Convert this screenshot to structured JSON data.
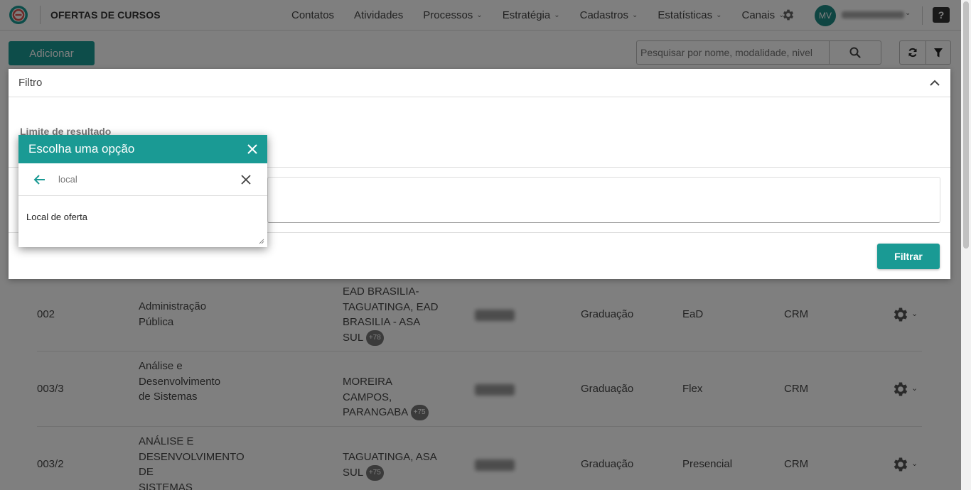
{
  "header": {
    "app_title": "OFERTAS DE CURSOS",
    "nav": [
      {
        "label": "Contatos",
        "dropdown": false
      },
      {
        "label": "Atividades",
        "dropdown": false
      },
      {
        "label": "Processos",
        "dropdown": true
      },
      {
        "label": "Estratégia",
        "dropdown": true
      },
      {
        "label": "Cadastros",
        "dropdown": true
      },
      {
        "label": "Estatísticas",
        "dropdown": true
      },
      {
        "label": "Canais",
        "dropdown": true
      }
    ],
    "avatar_initials": "MV",
    "help_label": "?"
  },
  "toolbar": {
    "add_label": "Adicionar",
    "search_placeholder": "Pesquisar por nome, modalidade, nivel"
  },
  "table": {
    "rows": [
      {
        "code": "002",
        "name": "Administração Pública",
        "local": "EAD BRASILIA-TAGUATINGA, EAD BRASILIA - ASA SUL",
        "badge": "+78",
        "level": "Graduação",
        "modality": "EaD",
        "origin": "CRM"
      },
      {
        "code": "003/3",
        "name": "Análise e Desenvolvimento de Sistemas",
        "local": "MOREIRA CAMPOS, PARANGABA",
        "badge": "+75",
        "level": "Graduação",
        "modality": "Flex",
        "origin": "CRM"
      },
      {
        "code": "003/2",
        "name": "ANÁLISE E DESENVOLVIMENTO DE SISTEMAS",
        "local": "TAGUATINGA, ASA SUL",
        "badge": "+75",
        "level": "Graduação",
        "modality": "Presencial",
        "origin": "CRM"
      }
    ]
  },
  "filter": {
    "title": "Filtro",
    "limit_label": "Limite de resultado",
    "submit_label": "Filtrar"
  },
  "chooser": {
    "title": "Escolha uma opção",
    "search_value": "local",
    "option": "Local de oferta"
  },
  "colors": {
    "primary": "#1a9a94",
    "overlay": "rgba(0,0,0,0.5)"
  }
}
